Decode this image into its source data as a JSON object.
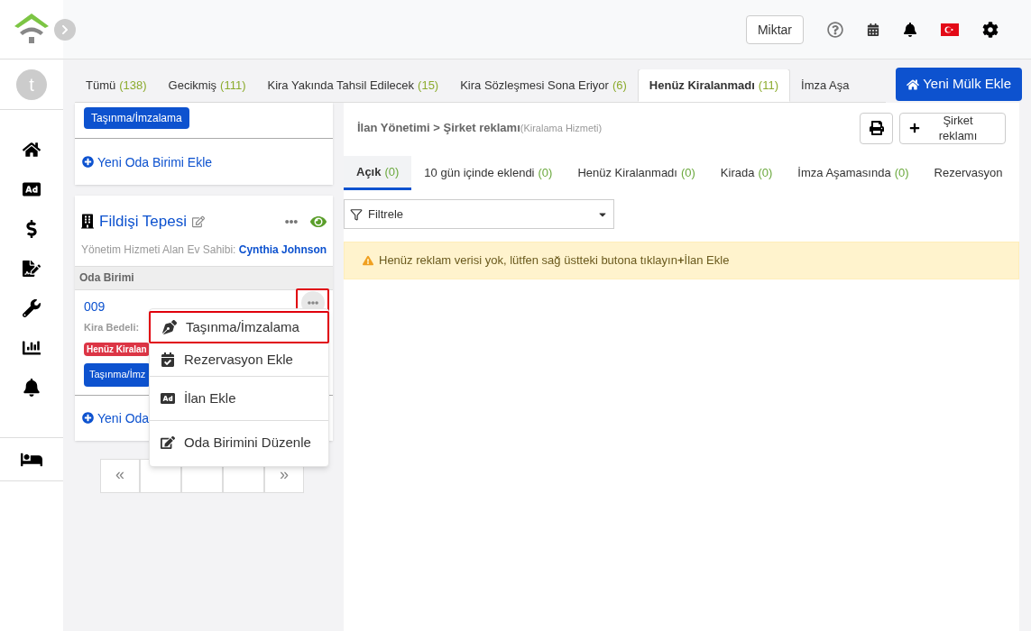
{
  "sidebar": {
    "avatar": "t"
  },
  "header": {
    "quantity_button": "Miktar"
  },
  "status_tabs": [
    {
      "label": "Tümü",
      "count": "(138)",
      "selected": false
    },
    {
      "label": "Gecikmiş",
      "count": "(111)",
      "selected": false
    },
    {
      "label": "Kira Yakında Tahsil Edilecek",
      "count": "(15)",
      "selected": false
    },
    {
      "label": "Kira Sözleşmesi Sona Eriyor",
      "count": "(6)",
      "selected": false
    },
    {
      "label": "Henüz Kiralanmadı",
      "count": "(11)",
      "selected": true
    },
    {
      "label": "İmza Aşa",
      "selected": false
    }
  ],
  "add_property_button": "Yeni Mülk Ekle",
  "previous_card": {
    "move_button": "Taşınma/İmzalama",
    "add_unit_link": "Yeni Oda Birimi Ekle"
  },
  "property": {
    "name": "Fildişi Tepesi",
    "manager_label": "Yönetim Hizmeti Alan Ev Sahibi:",
    "manager_name": "Cynthia Johnson",
    "section_label": "Oda Birimi",
    "unit": {
      "number": "009",
      "rent": "Kira Bedeli:",
      "status_badge": "Henüz Kiralan",
      "move_button": "Taşınma/İmz",
      "menu_highlighted": true
    },
    "add_unit_link": "Yeni Oda"
  },
  "pagination": [
    "«",
    "»"
  ],
  "menu": [
    {
      "label": "Taşınma/İmzalama",
      "highlighted": true,
      "kind": "sign"
    },
    {
      "label": "Rezervasyon Ekle",
      "highlighted": false,
      "kind": "calendar"
    },
    {
      "label": "İlan Ekle",
      "highlighted": false,
      "kind": "ad"
    },
    {
      "label": "Oda Birimini Düzenle",
      "highlighted": false,
      "kind": "edit"
    }
  ],
  "panel": {
    "breadcrumb": "İlan Yönetimi > Şirket reklamı",
    "breadcrumb_note": "(Kiralama Hizmeti)",
    "new_button": "Şirket reklamı",
    "tabs": [
      {
        "label": "Açık",
        "count": "(0)",
        "selected": true
      },
      {
        "label": "10 gün içinde eklendi",
        "count": "(0)",
        "selected": false
      },
      {
        "label": "Henüz Kiralanmadı",
        "count": "(0)",
        "selected": false
      },
      {
        "label": "Kirada",
        "count": "(0)",
        "selected": false
      },
      {
        "label": "İmza Aşamasında",
        "count": "(0)",
        "selected": false
      },
      {
        "label": "Rezervasyon",
        "selected": false
      }
    ],
    "filter": "Filtrele",
    "alert": "Henüz reklam verisi yok, lütfen sağ üstteki butona tıklayın**+**İlan Ekle"
  }
}
